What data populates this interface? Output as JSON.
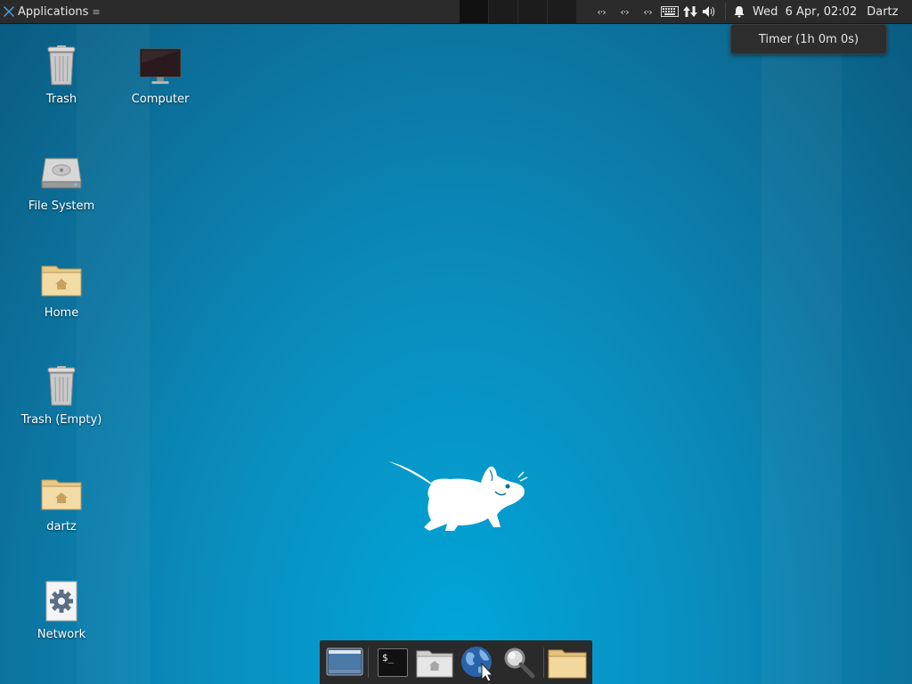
{
  "top_panel": {
    "applications_label": "Applications",
    "clock": "Wed  6 Apr, 02:02",
    "user": "Dartz"
  },
  "tooltip": {
    "text": "Timer (1h 0m 0s)"
  },
  "desktop_icons": [
    {
      "label": "Trash",
      "icon": "trash-icon"
    },
    {
      "label": "Computer",
      "icon": "computer-icon"
    },
    {
      "label": "File System",
      "icon": "drive-icon"
    },
    {
      "label": "Home",
      "icon": "home-folder-icon"
    },
    {
      "label": "Trash (Empty)",
      "icon": "trash-icon"
    },
    {
      "label": "dartz",
      "icon": "home-folder-icon"
    },
    {
      "label": "Network",
      "icon": "gear-icon"
    }
  ],
  "dock": {
    "items": [
      "show-desktop-icon",
      "terminal-icon",
      "file-manager-icon",
      "web-browser-icon",
      "search-icon",
      "folder-icon"
    ],
    "terminal_prompt": "$_"
  },
  "colors": {
    "panel": "#2b2b2b",
    "desktop": "#0a8cbd"
  }
}
